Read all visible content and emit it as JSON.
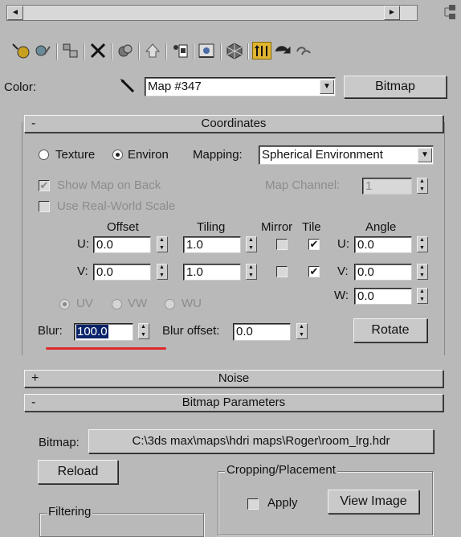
{
  "scrollbar": {
    "left_arrow": "◄",
    "right_arrow": "►"
  },
  "toolbar": {
    "icons": [
      "get-material-icon",
      "put-to-scene-icon",
      "assign-material-icon",
      "reset-map-icon",
      "make-unique-icon",
      "put-to-library-icon",
      "material-effects-channel-icon",
      "show-map-in-viewport-icon",
      "show-end-result-icon",
      "go-to-parent-icon",
      "go-forward-to-sibling-icon",
      "background-icon"
    ]
  },
  "header": {
    "color_label": "Color:",
    "map_name": "Map #347",
    "map_type_button": "Bitmap"
  },
  "coordinates": {
    "sign": "-",
    "title": "Coordinates",
    "texture_label": "Texture",
    "environ_label": "Environ",
    "mapping_label": "Mapping:",
    "mapping_value": "Spherical Environment",
    "show_map_on_back": "Show Map on Back",
    "map_channel_label": "Map Channel:",
    "map_channel_value": "1",
    "real_world_scale": "Use Real-World Scale",
    "offset_label": "Offset",
    "tiling_label": "Tiling",
    "mirror_label": "Mirror",
    "tile_label": "Tile",
    "angle_label": "Angle",
    "u_label": "U:",
    "v_label": "V:",
    "w_label": "W:",
    "u_offset": "0.0",
    "v_offset": "0.0",
    "u_tiling": "1.0",
    "v_tiling": "1.0",
    "u_angle": "0.0",
    "v_angle": "0.0",
    "w_angle": "0.0",
    "uv_label": "UV",
    "vw_label": "VW",
    "wu_label": "WU",
    "blur_label": "Blur:",
    "blur_value": "100.0",
    "blur_offset_label": "Blur offset:",
    "blur_offset_value": "0.0",
    "rotate_button": "Rotate",
    "tile_checkmark": "✔"
  },
  "noise": {
    "sign": "+",
    "title": "Noise"
  },
  "bitmap_params": {
    "sign": "-",
    "title": "Bitmap Parameters",
    "bitmap_label": "Bitmap:",
    "bitmap_path": "C:\\3ds max\\maps\\hdri maps\\Roger\\room_lrg.hdr",
    "reload_button": "Reload",
    "cropping_label": "Cropping/Placement",
    "apply_label": "Apply",
    "view_image_button": "View Image",
    "filtering_label": "Filtering"
  },
  "colors": {
    "highlight": "#0a246a",
    "annotation": "#e0282a"
  }
}
